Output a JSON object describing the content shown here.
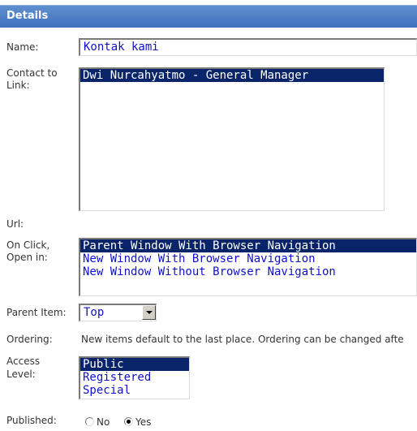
{
  "header": {
    "title": "Details"
  },
  "fields": {
    "name_label": "Name:",
    "name_value": "Kontak kami",
    "contact_label_1": "Contact to",
    "contact_label_2": "Link:",
    "contact_options": [
      "Dwi Nurcahyatmo - General Manager"
    ],
    "url_label": "Url:",
    "onclick_label_1": "On Click,",
    "onclick_label_2": "Open in:",
    "onclick_options": [
      "Parent Window With Browser Navigation",
      "New Window With Browser Navigation",
      "New Window Without Browser Navigation"
    ],
    "parent_label": "Parent Item:",
    "parent_value": "Top",
    "ordering_label": "Ordering:",
    "ordering_text": "New items default to the last place. Ordering can be changed afte",
    "access_label_1": "Access",
    "access_label_2": "Level:",
    "access_options": [
      "Public",
      "Registered",
      "Special"
    ],
    "published_label": "Published:",
    "published_no": "No",
    "published_yes": "Yes",
    "published_selected": "Yes"
  },
  "colors": {
    "header": "#3f72bd",
    "selection": "#0a246a",
    "field_text": "#1111cc"
  }
}
